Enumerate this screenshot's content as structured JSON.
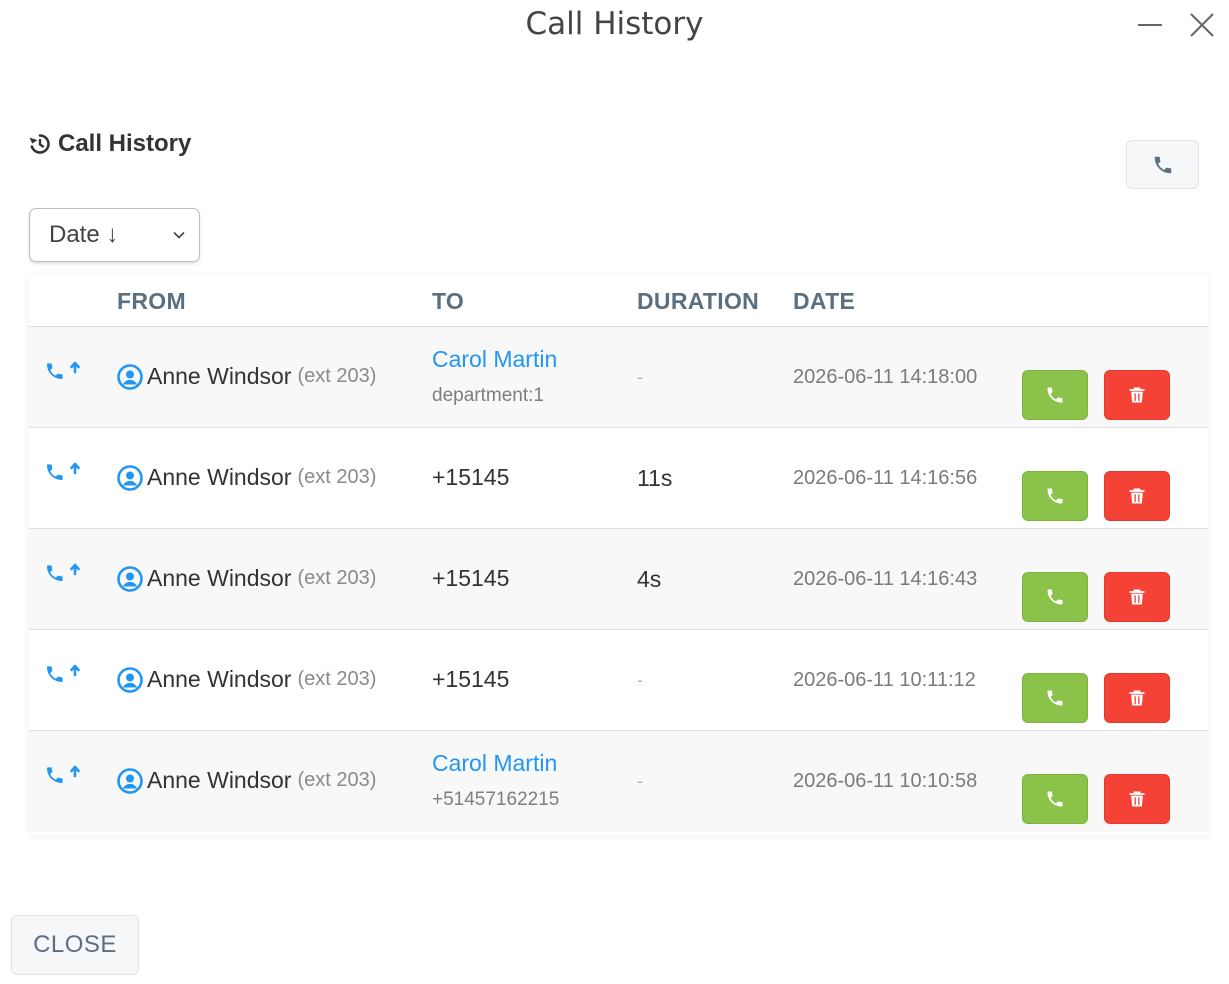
{
  "window": {
    "title": "Call History"
  },
  "section": {
    "title": "Call History"
  },
  "sort": {
    "selected": "Date ↓"
  },
  "table": {
    "headers": {
      "from": "FROM",
      "to": "TO",
      "duration": "DURATION",
      "date": "DATE"
    },
    "rows": [
      {
        "direction": "outgoing",
        "from_name": "Anne Windsor",
        "from_ext": "(ext 203)",
        "to_name": "Carol Martin",
        "to_sub": "department:1",
        "duration": "-",
        "date": "2026-06-11 14:18:00"
      },
      {
        "direction": "outgoing",
        "from_name": "Anne Windsor",
        "from_ext": "(ext 203)",
        "to_number": "+15145",
        "duration": "11s",
        "date": "2026-06-11 14:16:56"
      },
      {
        "direction": "outgoing",
        "from_name": "Anne Windsor",
        "from_ext": "(ext 203)",
        "to_number": "+15145",
        "duration": "4s",
        "date": "2026-06-11 14:16:43"
      },
      {
        "direction": "outgoing",
        "from_name": "Anne Windsor",
        "from_ext": "(ext 203)",
        "to_number": "+15145",
        "duration": "-",
        "date": "2026-06-11 10:11:12"
      },
      {
        "direction": "outgoing",
        "from_name": "Anne Windsor",
        "from_ext": "(ext 203)",
        "to_name": "Carol Martin",
        "to_sub": "+51457162215",
        "duration": "-",
        "date": "2026-06-11 10:10:58"
      }
    ]
  },
  "footer": {
    "close_label": "CLOSE"
  },
  "icons": {
    "history": "history-icon",
    "phone": "phone-icon",
    "outgoing_call": "outgoing-call-icon",
    "user": "user-circle-icon",
    "trash": "trash-icon",
    "minimize": "minimize-icon",
    "close": "close-icon",
    "chevron": "chevron-down-icon"
  },
  "colors": {
    "accent_blue": "#2196f3",
    "call_green": "#8bc34a",
    "delete_red": "#f44336",
    "header_text": "#5a6f80"
  }
}
